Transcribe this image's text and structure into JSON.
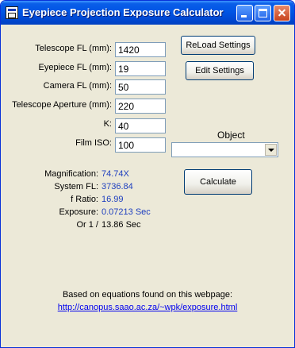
{
  "window": {
    "title": "Eyepiece Projection Exposure Calculator"
  },
  "inputs": {
    "telescope_fl": {
      "label": "Telescope FL (mm):",
      "value": "1420"
    },
    "eyepiece_fl": {
      "label": "Eyepiece FL (mm):",
      "value": "19"
    },
    "camera_fl": {
      "label": "Camera FL (mm):",
      "value": "50"
    },
    "telescope_aperture": {
      "label": "Telescope Aperture (mm):",
      "value": "220"
    },
    "k": {
      "label": "K:",
      "value": "40"
    },
    "film_iso": {
      "label": "Film ISO:",
      "value": "100"
    }
  },
  "buttons": {
    "reload": "ReLoad Settings",
    "edit": "Edit Settings",
    "calculate": "Calculate"
  },
  "object": {
    "label": "Object",
    "selected": ""
  },
  "results": {
    "magnification": {
      "label": "Magnification:",
      "value": "74.74X"
    },
    "system_fl": {
      "label": "System FL:",
      "value": "3736.84"
    },
    "f_ratio": {
      "label": "f Ratio:",
      "value": "16.99"
    },
    "exposure": {
      "label": "Exposure:",
      "value": "0.07213 Sec"
    },
    "or_one_over": {
      "label": "Or 1 /",
      "value": "13.86 Sec"
    }
  },
  "footer": {
    "text": "Based on equations found on this webpage:",
    "link": "http://canopus.saao.ac.za/~wpk/exposure.html"
  },
  "colors": {
    "title_bar": "#0055e5",
    "result_value": "#1e3fbf",
    "link": "#0000ee"
  }
}
